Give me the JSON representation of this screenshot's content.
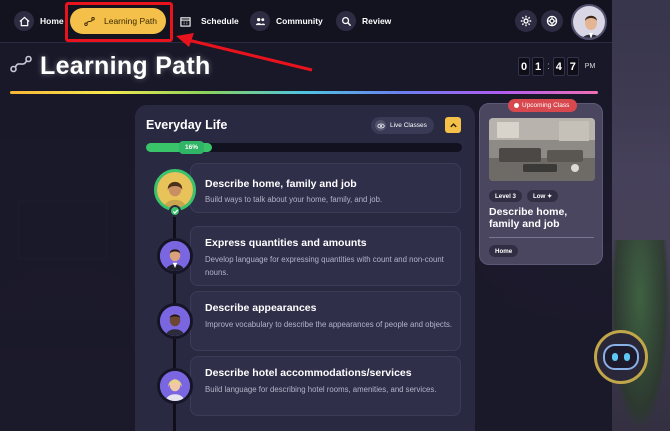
{
  "nav": {
    "home": "Home",
    "learning_path": "Learning Path",
    "schedule": "Schedule",
    "community": "Community",
    "review": "Review"
  },
  "page": {
    "title": "Learning Path",
    "clock": {
      "d1": "0",
      "d2": "1",
      "d3": "4",
      "d4": "7",
      "ampm": "PM"
    }
  },
  "unit": {
    "title": "Everyday Life",
    "live_classes": "Live Classes",
    "progress_label": "16%",
    "progress_value": 0.16,
    "lessons": [
      {
        "title": "Describe home, family and job",
        "desc": "Build ways to talk about your home, family, and job."
      },
      {
        "title": "Express quantities and amounts",
        "desc": "Develop language for expressing quantities with count and non-count nouns."
      },
      {
        "title": "Describe appearances",
        "desc": "Improve vocabulary to describe the appearances of people and objects."
      },
      {
        "title": "Describe hotel accommodations/services",
        "desc": "Build language for describing hotel rooms, amenities, and services."
      }
    ]
  },
  "upcoming": {
    "badge": "Upcoming Class",
    "level": "Level 3",
    "intensity": "Low ✦",
    "title": "Describe home, family and job",
    "tag": "Home"
  },
  "colors": {
    "accent": "#f5c04a",
    "progress": "#39c46a",
    "badge_red": "#d8484f",
    "annotation": "#e8131c"
  }
}
